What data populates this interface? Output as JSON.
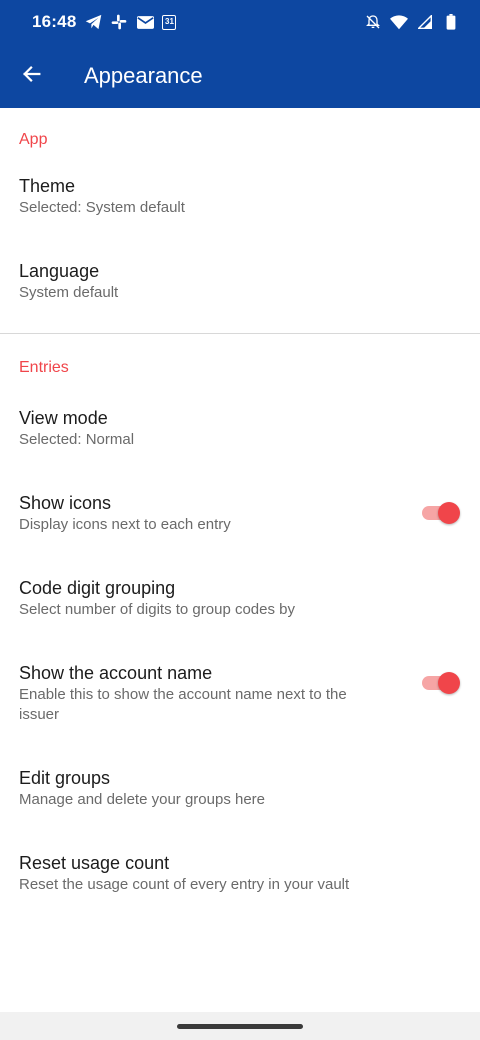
{
  "status_bar": {
    "time": "16:48",
    "calendar_day": "31",
    "left_icons": [
      "telegram-icon",
      "slack-icon",
      "mail-icon",
      "calendar-icon"
    ],
    "right_icons": [
      "notifications-off-icon",
      "wifi-icon",
      "cellular-signal-icon",
      "battery-icon"
    ]
  },
  "app_bar": {
    "title": "Appearance",
    "back_icon": "arrow-back-icon"
  },
  "colors": {
    "primary": "#0d47a1",
    "accent": "#f0454a",
    "switch_track": "#f6a5a5"
  },
  "sections": {
    "app": {
      "header": "App",
      "items": [
        {
          "title": "Theme",
          "summary": "Selected: System default"
        },
        {
          "title": "Language",
          "summary": "System default"
        }
      ]
    },
    "entries": {
      "header": "Entries",
      "items": [
        {
          "title": "View mode",
          "summary": "Selected: Normal"
        },
        {
          "title": "Show icons",
          "summary": "Display icons next to each entry",
          "switch": true
        },
        {
          "title": "Code digit grouping",
          "summary": "Select number of digits to group codes by"
        },
        {
          "title": "Show the account name",
          "summary": "Enable this to show the account name next to the issuer",
          "switch": true
        },
        {
          "title": "Edit groups",
          "summary": "Manage and delete your groups here"
        },
        {
          "title": "Reset usage count",
          "summary": "Reset the usage count of every entry in your vault"
        }
      ]
    }
  }
}
